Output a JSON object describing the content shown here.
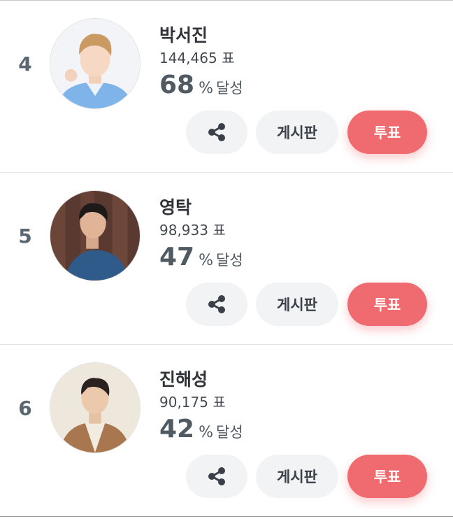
{
  "colors": {
    "vote_button": "#f06b70",
    "secondary_button": "#f1f3f5",
    "rank_text": "#5a6670"
  },
  "labels": {
    "board": "게시판",
    "vote": "투표",
    "percent_sign": "%",
    "achieved": "달성"
  },
  "icons": {
    "share": "share-icon"
  },
  "ranking": [
    {
      "rank": "4",
      "name": "박서진",
      "votes": "144,465 표",
      "percent": "68"
    },
    {
      "rank": "5",
      "name": "영탁",
      "votes": "98,933 표",
      "percent": "47"
    },
    {
      "rank": "6",
      "name": "진해성",
      "votes": "90,175 표",
      "percent": "42"
    }
  ]
}
